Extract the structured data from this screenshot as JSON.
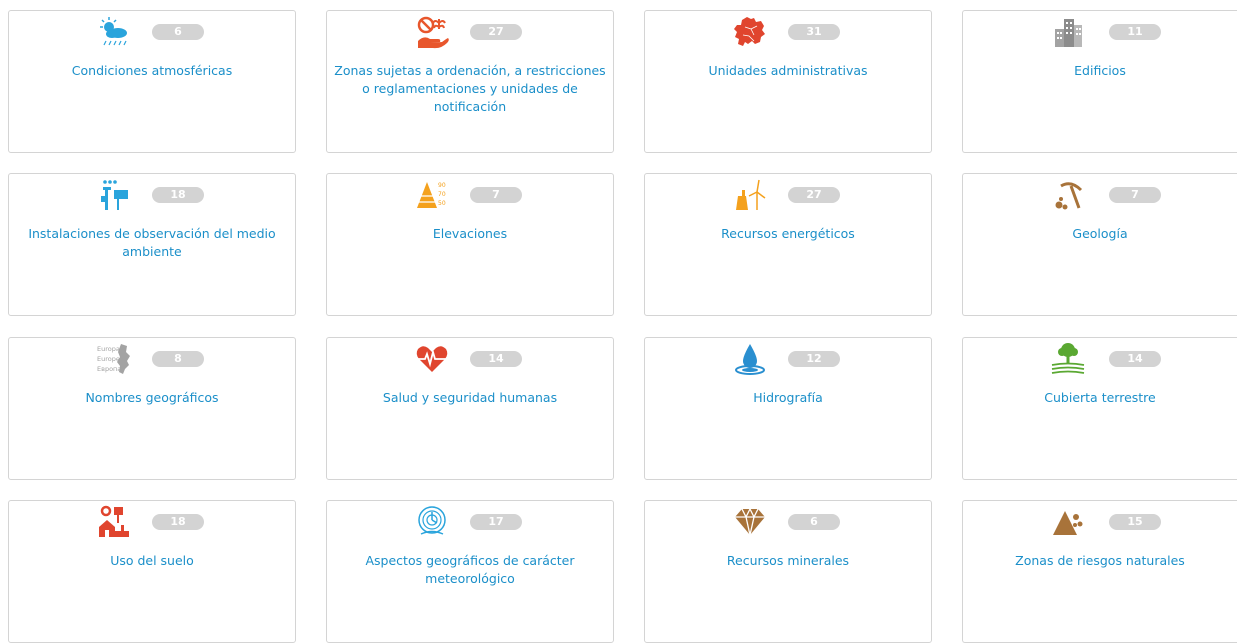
{
  "categories": [
    {
      "title": "Condiciones atmosféricas",
      "count": "6",
      "icon": "weather-icon",
      "color": "#2aa4dc"
    },
    {
      "title": "Zonas sujetas a ordenación, a restricciones o reglamentaciones y unidades de notificación",
      "count": "27",
      "icon": "restricted-zone-icon",
      "color": "#e8562c"
    },
    {
      "title": "Unidades administrativas",
      "count": "31",
      "icon": "europe-map-icon",
      "color": "#e0452e"
    },
    {
      "title": "Edificios",
      "count": "11",
      "icon": "buildings-icon",
      "color": "#a3a3a3"
    },
    {
      "title": "Instalaciones de observación del medio ambiente",
      "count": "18",
      "icon": "monitoring-station-icon",
      "color": "#2aa4dc"
    },
    {
      "title": "Elevaciones",
      "count": "7",
      "icon": "elevation-icon",
      "color": "#f4a11d"
    },
    {
      "title": "Recursos energéticos",
      "count": "27",
      "icon": "energy-icon",
      "color": "#f4a11d"
    },
    {
      "title": "Geología",
      "count": "7",
      "icon": "geology-icon",
      "color": "#a8733a"
    },
    {
      "title": "Nombres geográficos",
      "count": "8",
      "icon": "geographic-names-icon",
      "color": "#a3a3a3"
    },
    {
      "title": "Salud y seguridad humanas",
      "count": "14",
      "icon": "heart-pulse-icon",
      "color": "#e0452e"
    },
    {
      "title": "Hidrografía",
      "count": "12",
      "icon": "water-drop-icon",
      "color": "#2a8fd0"
    },
    {
      "title": "Cubierta terrestre",
      "count": "14",
      "icon": "land-cover-icon",
      "color": "#5aa832"
    },
    {
      "title": "Uso del suelo",
      "count": "18",
      "icon": "land-use-icon",
      "color": "#e0452e"
    },
    {
      "title": "Aspectos geográficos de carácter meteorológico",
      "count": "17",
      "icon": "meteorological-icon",
      "color": "#2aa4dc"
    },
    {
      "title": "Recursos minerales",
      "count": "6",
      "icon": "diamond-icon",
      "color": "#a8733a"
    },
    {
      "title": "Zonas de riesgos naturales",
      "count": "15",
      "icon": "natural-hazard-icon",
      "color": "#a8733a"
    }
  ],
  "elevation_labels": [
    "90",
    "70",
    "50"
  ],
  "names_labels": [
    "Europa",
    "Europe",
    "Европа"
  ]
}
